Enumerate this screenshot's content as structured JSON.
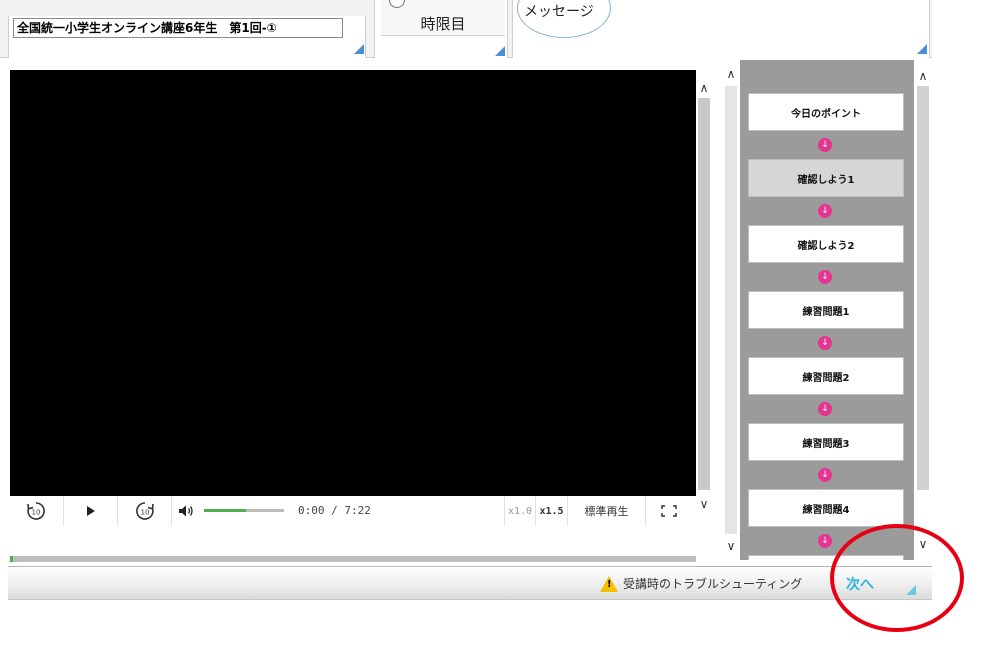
{
  "header": {
    "course_title": "全国統一小学生オンライン講座6年生　第1回-①",
    "period_label": "時限目",
    "message_label": "メッセージ"
  },
  "player": {
    "time": "0:00 / 7:22",
    "speed_options": [
      "x1.0",
      "x1.5"
    ],
    "normal_speed_label": "標準再生",
    "rewind_label": "10",
    "forward_label": "10",
    "volume_level": 0.52,
    "progress": 0.0
  },
  "sidebar": {
    "steps": [
      {
        "label": "今日のポイント",
        "active": false
      },
      {
        "label": "確認しよう1",
        "active": true
      },
      {
        "label": "確認しよう2",
        "active": false
      },
      {
        "label": "練習問題1",
        "active": false
      },
      {
        "label": "練習問題2",
        "active": false
      },
      {
        "label": "練習問題3",
        "active": false
      },
      {
        "label": "練習問題4",
        "active": false
      }
    ]
  },
  "footer": {
    "troubleshooting_label": "受講時のトラブルシューティング",
    "next_label": "次へ"
  },
  "icons": {
    "rewind": "rewind-10-icon",
    "play": "play-icon",
    "forward": "forward-10-icon",
    "volume": "volume-icon",
    "fullscreen": "fullscreen-icon",
    "step_arrow": "arrow-down-circle-icon",
    "warning": "warning-icon"
  },
  "colors": {
    "accent_green": "#4caf50",
    "step_arrow_pink": "#e4358f",
    "next_blue": "#29b6e0",
    "annotation_red": "#e60012"
  }
}
